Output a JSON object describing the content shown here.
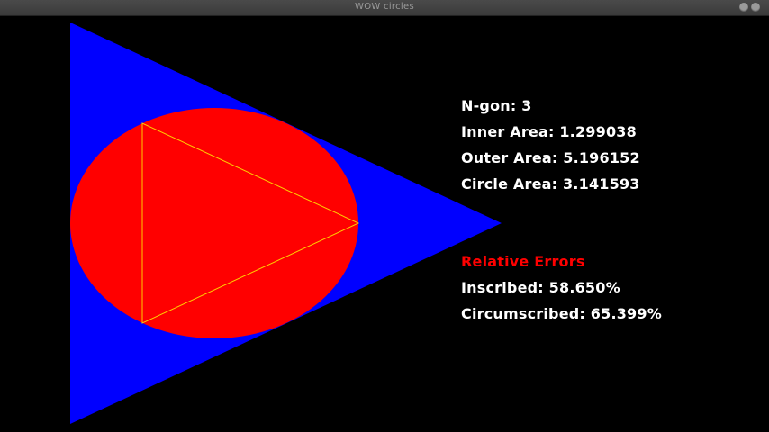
{
  "window": {
    "title": "WOW circles"
  },
  "colors": {
    "background": "#000000",
    "outer_polygon": "#0000ff",
    "circle": "#ff0000",
    "inner_polygon_stroke": "#ffcc00",
    "text": "#ffffff",
    "heading": "#ff0000"
  },
  "stats": {
    "ngon": "N-gon: 3",
    "inner_area": "Inner Area: 1.299038",
    "outer_area": "Outer Area: 5.196152",
    "circle_area": "Circle Area: 3.141593"
  },
  "errors": {
    "heading": "Relative Errors",
    "inscribed": "Inscribed: 58.650%",
    "circumscribed": "Circumscribed: 65.399%"
  }
}
